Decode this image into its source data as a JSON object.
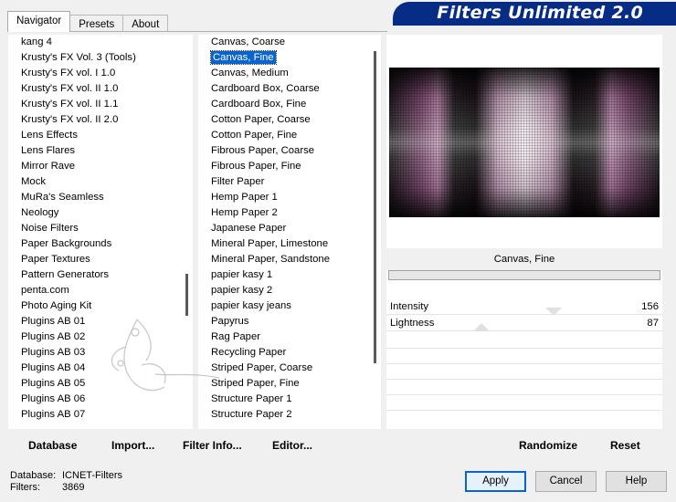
{
  "tabs": [
    {
      "label": "Navigator",
      "active": true
    },
    {
      "label": "Presets",
      "active": false
    },
    {
      "label": "About",
      "active": false
    }
  ],
  "banner": {
    "title": "Filters Unlimited 2.0",
    "color": "#062c86"
  },
  "categories": [
    "kang 4",
    "Krusty's FX Vol. 3 (Tools)",
    "Krusty's FX vol. I 1.0",
    "Krusty's FX vol. II 1.0",
    "Krusty's FX vol. II 1.1",
    "Krusty's FX vol. II 2.0",
    "Lens Effects",
    "Lens Flares",
    "Mirror Rave",
    "Mock",
    "MuRa's Seamless",
    "Neology",
    "Noise Filters",
    "Paper Backgrounds",
    "Paper Textures",
    "Pattern Generators",
    "penta.com",
    "Photo Aging Kit",
    "Plugins AB 01",
    "Plugins AB 02",
    "Plugins AB 03",
    "Plugins AB 04",
    "Plugins AB 05",
    "Plugins AB 06",
    "Plugins AB 07"
  ],
  "filters": [
    "Canvas, Coarse",
    "Canvas, Fine",
    "Canvas, Medium",
    "Cardboard Box, Coarse",
    "Cardboard Box, Fine",
    "Cotton Paper, Coarse",
    "Cotton Paper, Fine",
    "Fibrous Paper, Coarse",
    "Fibrous Paper, Fine",
    "Filter Paper",
    "Hemp Paper 1",
    "Hemp Paper 2",
    "Japanese Paper",
    "Mineral Paper, Limestone",
    "Mineral Paper, Sandstone",
    "papier kasy 1",
    "papier kasy 2",
    "papier kasy jeans",
    "Papyrus",
    "Rag Paper",
    "Recycling Paper",
    "Striped Paper, Coarse",
    "Striped Paper, Fine",
    "Structure Paper 1",
    "Structure Paper 2"
  ],
  "selected_filter_index": 1,
  "preview": {
    "filter_name": "Canvas, Fine",
    "params": [
      {
        "label": "Intensity",
        "value": "156"
      },
      {
        "label": "Lightness",
        "value": "87"
      }
    ]
  },
  "bottom_buttons": {
    "database": "Database",
    "import": "Import...",
    "filter_info": "Filter Info...",
    "editor": "Editor...",
    "randomize": "Randomize",
    "reset": "Reset"
  },
  "status": {
    "database_label": "Database:",
    "database_value": "ICNET-Filters",
    "filters_label": "Filters:",
    "filters_value": "3869"
  },
  "dialog_buttons": {
    "apply": "Apply",
    "cancel": "Cancel",
    "help": "Help"
  },
  "colors": {
    "selection": "#0a64d0",
    "banner": "#062c86"
  }
}
